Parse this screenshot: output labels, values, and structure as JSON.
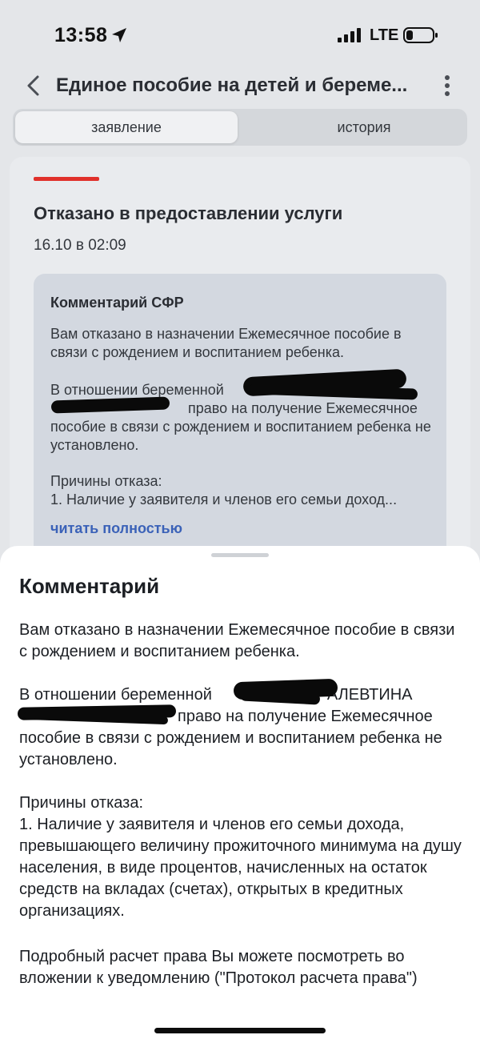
{
  "status_bar": {
    "time": "13:58",
    "network": "LTE"
  },
  "header": {
    "title": "Единое пособие на детей и береме..."
  },
  "tabs": [
    {
      "label": "заявление",
      "active": true
    },
    {
      "label": "история",
      "active": false
    }
  ],
  "card": {
    "status_color": "#e0302a",
    "title": "Отказано в предоставлении услуги",
    "date": "16.10 в 02:09",
    "comment": {
      "title": "Комментарий СФР",
      "p1": "Вам отказано в назначении Ежемесячное пособие в связи с рождением и воспитанием ребенка.",
      "p2_start": "В отношении беременной",
      "p2_rest": "право на получение Ежемесячное пособие в связи с рождением и воспитанием ребенка не установлено.",
      "p3_line1": "Причины отказа:",
      "p3_line2": "1. Наличие у заявителя и членов его семьи доход...",
      "read_more": "читать полностью"
    }
  },
  "sheet": {
    "title": "Комментарий",
    "p1": "Вам отказано в назначении Ежемесячное пособие в связи с рождением и воспитанием ребенка.",
    "p2_start": "В отношении беременной",
    "p2_name": "АЛЕВТИНА",
    "p2_rest": "право на получение Ежемесячное пособие в связи с рождением и воспитанием ребенка не установлено.",
    "p3_line1": "Причины отказа:",
    "p3_line2": "1. Наличие у заявителя и членов его семьи дохода, превышающего величину прожиточного минимума на душу населения, в виде процентов, начисленных на остаток средств на вкладах (счетах), открытых в кредитных организациях.",
    "p4": "Подробный расчет права Вы можете посмотреть во вложении к уведомлению (\"Протокол расчета права\")"
  },
  "colors": {
    "link": "#3b62b8",
    "refusal": "#e0302a"
  }
}
